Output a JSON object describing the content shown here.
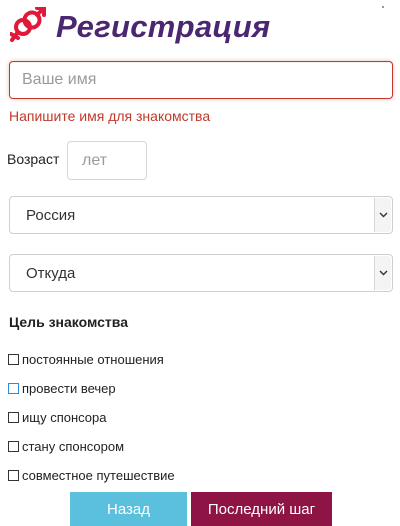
{
  "header": {
    "title": "Регистрация"
  },
  "form": {
    "name_placeholder": "Ваше имя",
    "name_error": "Напишите имя для знакомства",
    "age_label": "Возраст",
    "age_placeholder": "лет",
    "country_value": "Россия",
    "city_value": "Откуда",
    "goal_title": "Цель знакомства",
    "goals": [
      {
        "label": "постоянные отношения",
        "checked": false
      },
      {
        "label": "провести вечер",
        "checked": false,
        "focused": true
      },
      {
        "label": "ищу спонсора",
        "checked": false
      },
      {
        "label": "стану спонсором",
        "checked": false
      },
      {
        "label": "совместное путешествие",
        "checked": false
      }
    ]
  },
  "buttons": {
    "back": "Назад",
    "next": "Последний шаг"
  },
  "colors": {
    "title": "#4a2770",
    "logo": "#e2183b",
    "error": "#c0392b",
    "back_button": "#5bc0de",
    "next_button": "#8e1446"
  }
}
